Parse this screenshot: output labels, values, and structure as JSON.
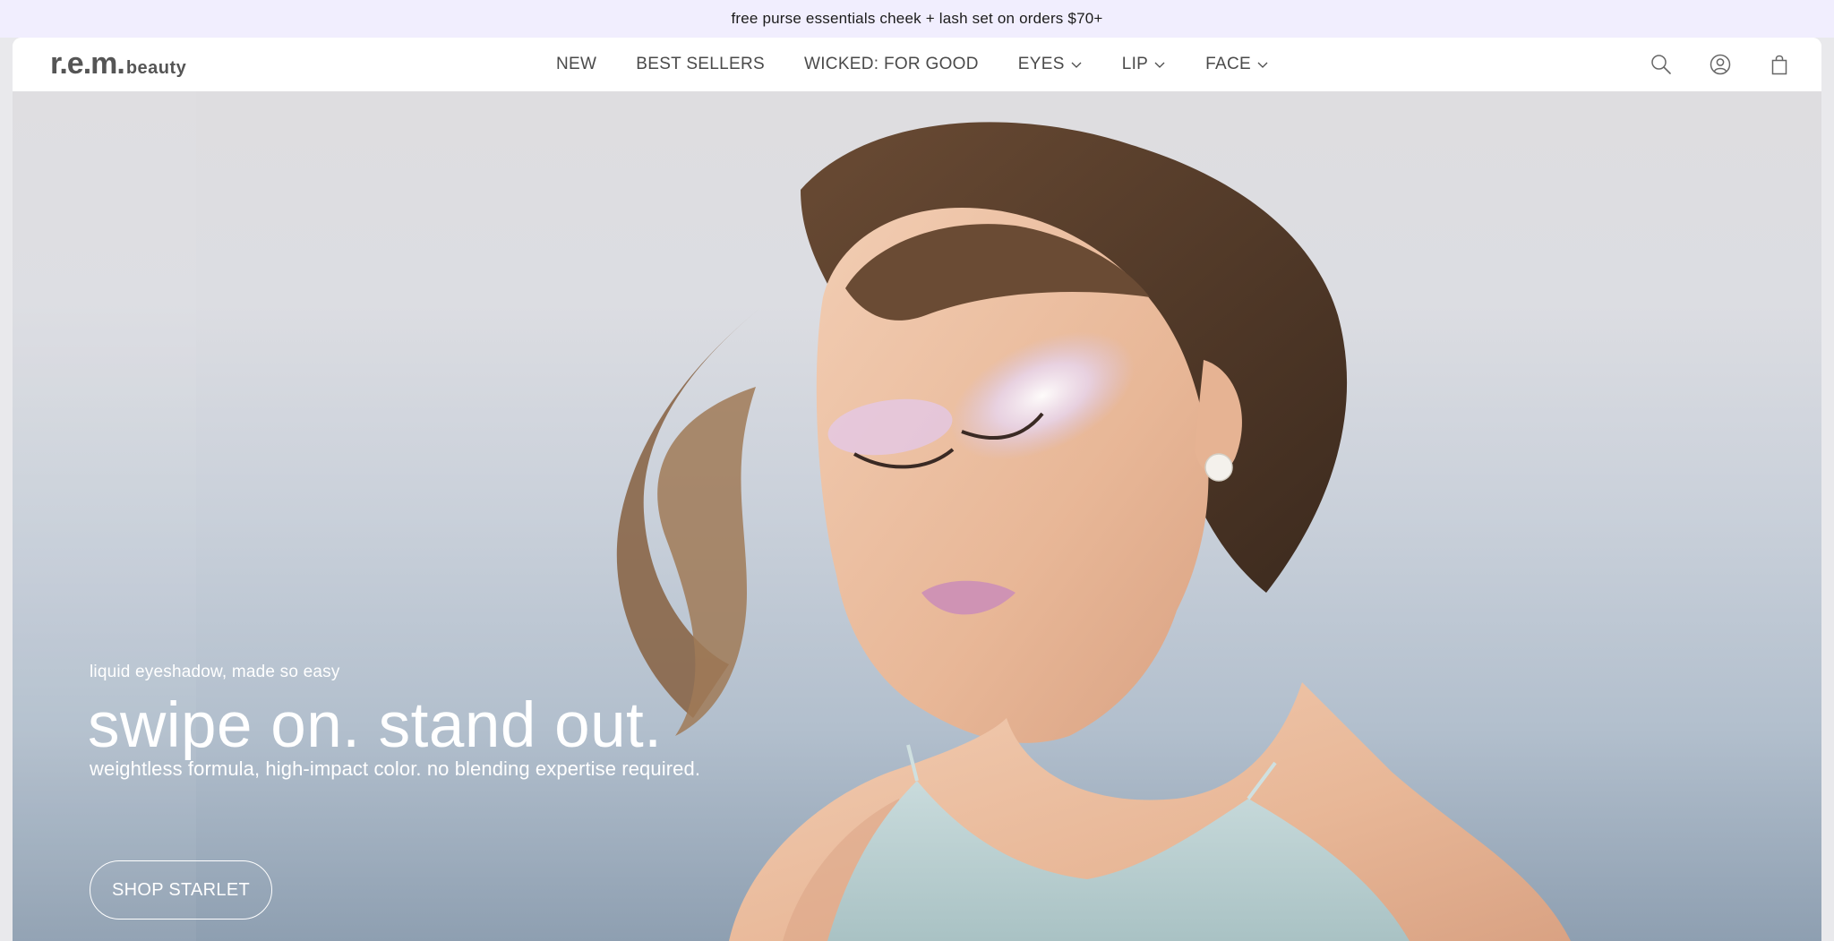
{
  "announcement": {
    "text": "free purse essentials cheek + lash set on orders $70+"
  },
  "header": {
    "logo": {
      "primary": "r.e.m.",
      "secondary": "beauty"
    },
    "nav": [
      {
        "label": "NEW",
        "has_dropdown": false
      },
      {
        "label": "BEST SELLERS",
        "has_dropdown": false
      },
      {
        "label": "WICKED: FOR GOOD",
        "has_dropdown": false
      },
      {
        "label": "EYES",
        "has_dropdown": true
      },
      {
        "label": "LIP",
        "has_dropdown": true
      },
      {
        "label": "FACE",
        "has_dropdown": true
      }
    ],
    "icons": [
      "search-icon",
      "account-icon",
      "cart-icon"
    ]
  },
  "hero": {
    "eyebrow": "liquid eyeshadow, made so easy",
    "headline": "swipe on. stand out.",
    "subhead": "weightless formula, high-impact color. no blending expertise required.",
    "cta_label": "SHOP STARLET"
  },
  "colors": {
    "announcement_bg": "#f1eefe",
    "nav_text": "#4a4a4a",
    "hero_text": "#ffffff",
    "hero_bg_top": "#dedde0",
    "hero_bg_bottom": "#8e9fb1"
  }
}
